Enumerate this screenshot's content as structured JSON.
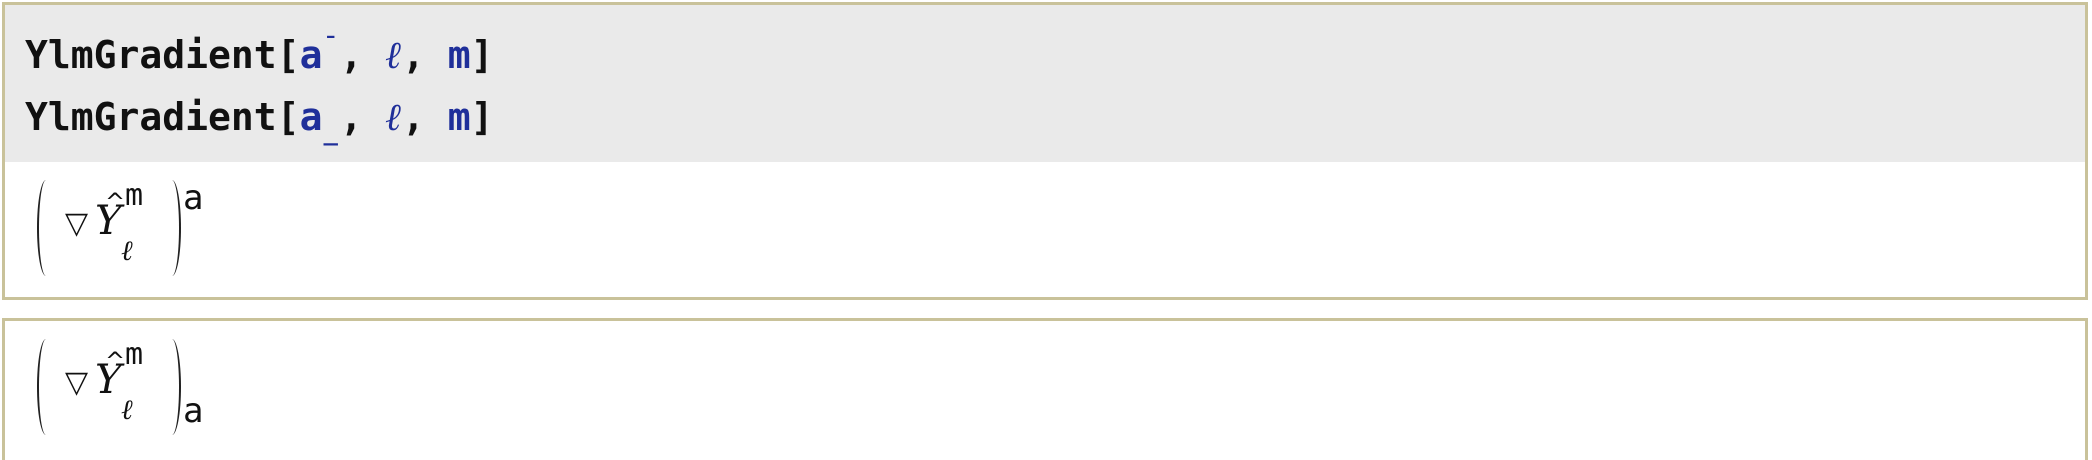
{
  "inputs": [
    {
      "function": "YlmGradient",
      "open": "[",
      "arg1": "a",
      "arg1_mark": "¯",
      "sep1": ",",
      "arg2": "ℓ",
      "sep2": ",",
      "arg3": "m",
      "close": "]"
    },
    {
      "function": "YlmGradient",
      "open": "[",
      "arg1": "a",
      "arg1_mark": "_",
      "sep1": ",",
      "arg2": "ℓ",
      "sep2": ",",
      "arg3": "m",
      "close": "]"
    }
  ],
  "outputs": [
    {
      "nabla": "▽",
      "symbol": "Y",
      "hat": "^",
      "superscript": "m",
      "subscript": "ℓ",
      "index": "a",
      "index_position": "upper"
    },
    {
      "nabla": "▽",
      "symbol": "Y",
      "hat": "^",
      "superscript": "m",
      "subscript": "ℓ",
      "index": "a",
      "index_position": "lower"
    }
  ],
  "colors": {
    "cell_border": "#c9c29a",
    "input_background": "#eaeaea",
    "argument_blue": "#1f2f9a",
    "text": "#111111"
  }
}
